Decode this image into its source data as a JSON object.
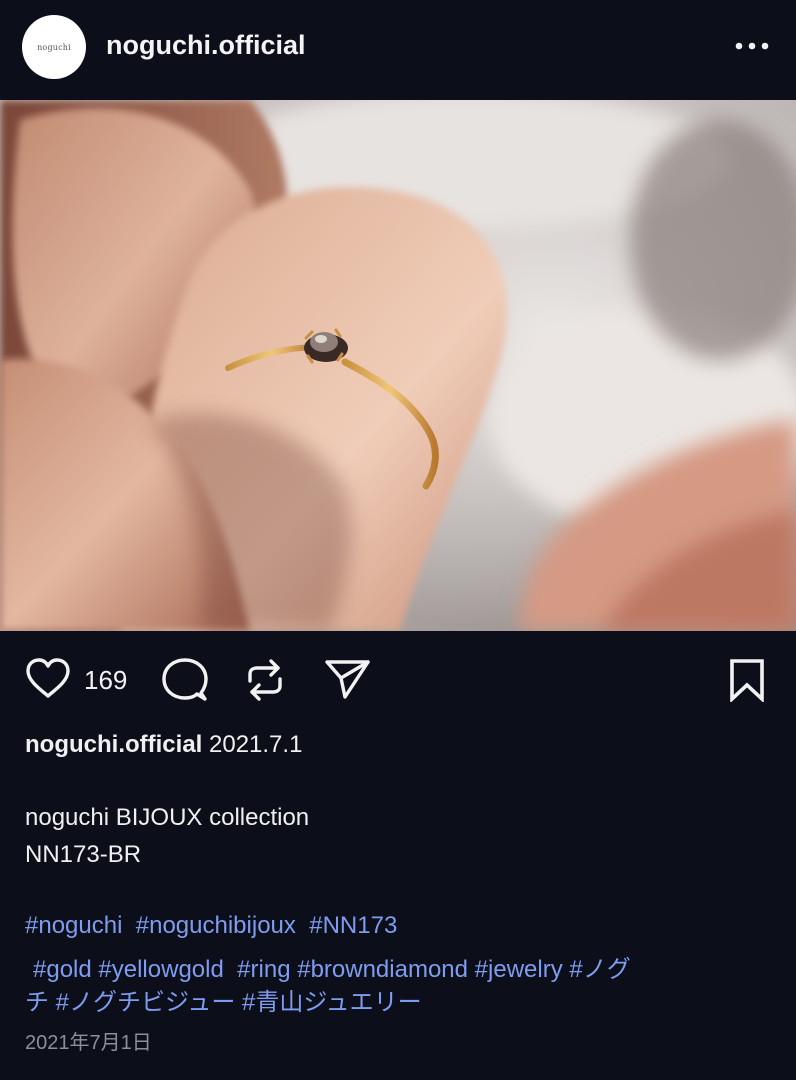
{
  "post": {
    "username": "noguchi.official",
    "avatar_text": "noguchi",
    "likes": "169",
    "caption": {
      "username": "noguchi.official",
      "date_inline": "2021.7.1",
      "line1": "noguchi BIJOUX collection",
      "line2": "NN173-BR"
    },
    "hashtags_line1": [
      "#noguchi",
      "#noguchibijoux",
      "#NN173"
    ],
    "hashtags_line2": [
      "#gold",
      "#yellowgold",
      "#ring",
      "#browndiamond",
      "#jewelry",
      "#ノグ"
    ],
    "hashtags_line3": [
      "チ",
      "#ノグチビジュー",
      "#青山ジュエリー"
    ],
    "date": "2021年7月1日"
  },
  "icons": {
    "more": "more-icon",
    "like": "heart-icon",
    "comment": "comment-icon",
    "repost": "repost-icon",
    "share": "send-icon",
    "save": "bookmark-icon"
  },
  "colors": {
    "background": "#0c0f19",
    "hashtag": "#7e9cf0",
    "text": "#f2f2f2",
    "muted": "#8c8f96"
  }
}
